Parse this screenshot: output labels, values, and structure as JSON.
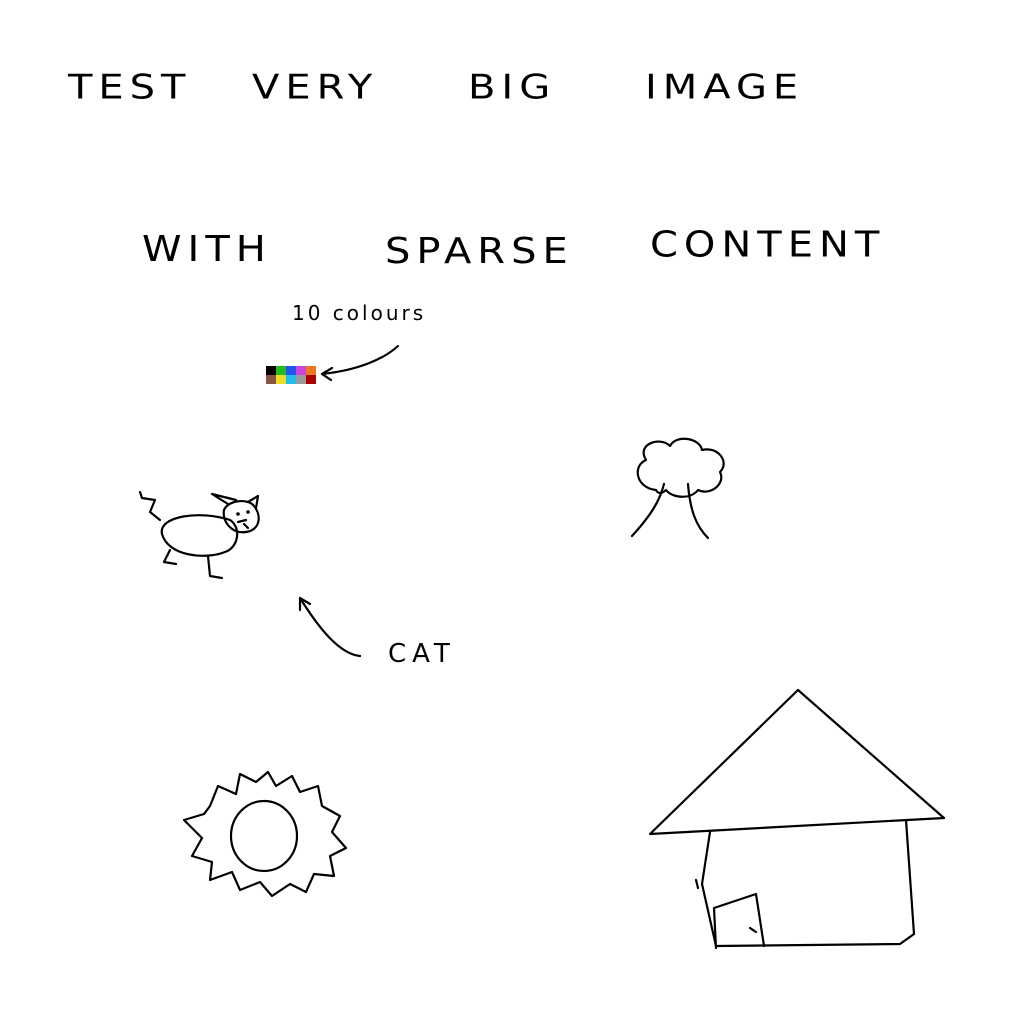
{
  "title_line_1": [
    "TEST",
    "VERY",
    "BIG",
    "IMAGE"
  ],
  "title_line_2": [
    "WITH",
    "SPARSE",
    "CONTENT"
  ],
  "palette_label": "10 colours",
  "palette_colors": [
    "#000000",
    "#22bb22",
    "#2255ee",
    "#cc44dd",
    "#ee7722",
    "#885544",
    "#eedd22",
    "#22bbee",
    "#999999",
    "#aa0000"
  ],
  "cat_label": "CAT",
  "drawings": [
    "cat",
    "tree",
    "sun",
    "house"
  ]
}
